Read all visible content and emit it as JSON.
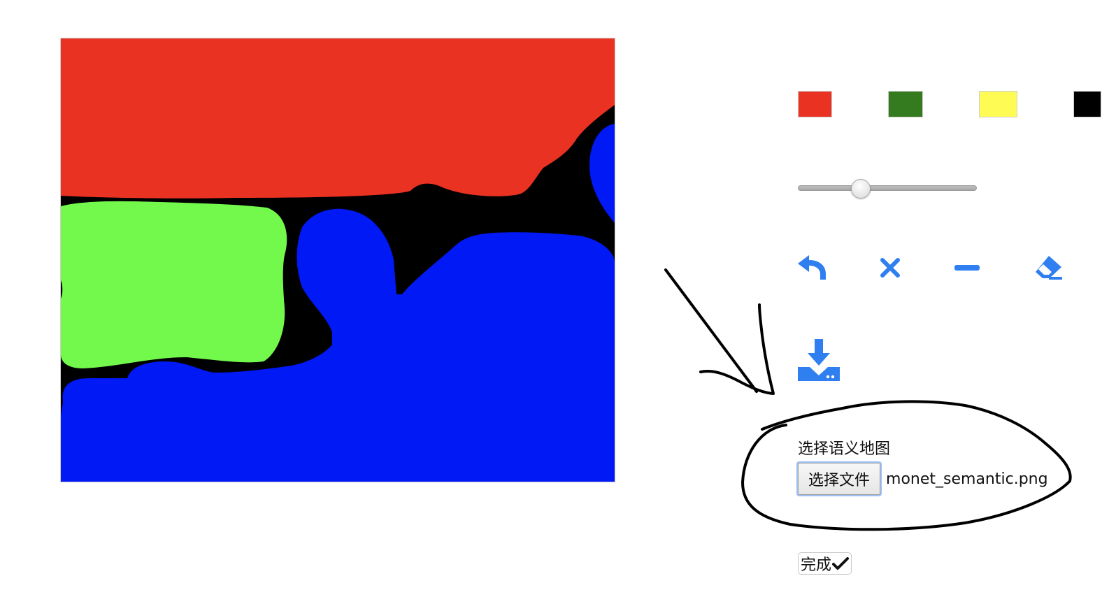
{
  "colors": {
    "accent_icon": "#2f7ff0",
    "canvas_background": "#000000",
    "region_red": "#ea3223",
    "region_green": "#72f94c",
    "region_blue": "#0019f5"
  },
  "palette": [
    {
      "name": "red",
      "color": "#ea3223"
    },
    {
      "name": "green",
      "color": "#347b20"
    },
    {
      "name": "yellow",
      "color": "#fefb54"
    },
    {
      "name": "black",
      "color": "#000000"
    }
  ],
  "brush_size": {
    "value_fraction": 0.35
  },
  "tools": [
    {
      "name": "undo",
      "icon": "undo-icon"
    },
    {
      "name": "clear",
      "icon": "close-icon"
    },
    {
      "name": "line",
      "icon": "minus-icon"
    },
    {
      "name": "eraser",
      "icon": "eraser-icon"
    }
  ],
  "download": {
    "icon": "download-icon"
  },
  "semantic_map": {
    "label": "选择语义地图",
    "button_label": "选择文件",
    "file_name": "monet_semantic.png"
  },
  "done": {
    "label": "完成",
    "icon": "check-icon"
  }
}
